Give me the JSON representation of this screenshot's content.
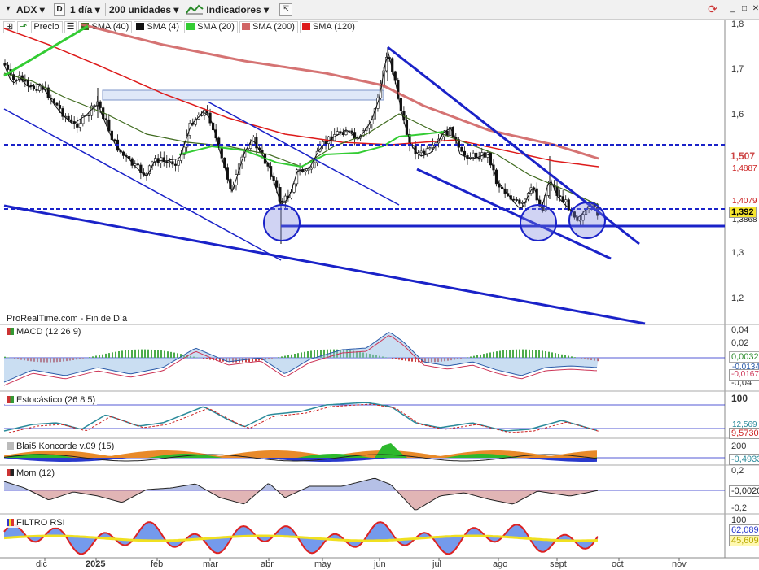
{
  "toolbar": {
    "symbol": "ADX",
    "mode_icon": "D",
    "period": "1 día",
    "units": "200 unidades",
    "indicators": "Indicadores"
  },
  "legend": {
    "precio": "Precio",
    "sma40": "SMA (40)",
    "sma4": "SMA (4)",
    "sma20": "SMA (20)",
    "sma200": "SMA (200)",
    "sma120": "SMA (120)"
  },
  "main": {
    "source_label": "ProRealTime.com - Fin de Día",
    "y_ticks": [
      "1,8",
      "1,7",
      "1,6",
      "1,5",
      "1,4",
      "1,3",
      "1,2"
    ],
    "tags": {
      "sma200": "1,507",
      "sma120": "1,4887",
      "sma40": "1,4079",
      "price": "1,392",
      "sma4": "1,3868"
    }
  },
  "panels": {
    "macd": {
      "label": "MACD (12 26 9)",
      "ticks": [
        "0,04",
        "0,02",
        "0",
        "-0,02",
        "-0,04"
      ],
      "v1": "0,0032",
      "v2": "-0,0134",
      "v3": "-0,0167"
    },
    "stoch": {
      "label": "Estocástico (26 8 5)",
      "ticks": [
        "100"
      ],
      "v1": "12,569",
      "v2": "9,5730"
    },
    "koncorde": {
      "label": "Blai5 Koncorde v.09 (15)",
      "ticks": [
        "200"
      ],
      "v1": "-0,4933"
    },
    "mom": {
      "label": "Mom (12)",
      "ticks": [
        "0,2",
        "-0,2"
      ],
      "v1": "-0,0020"
    },
    "rsi": {
      "label": "FILTRO RSI",
      "ticks": [
        "100"
      ],
      "v1": "62,089",
      "v2": "45,609"
    }
  },
  "x_axis": [
    "dic",
    "2025",
    "feb",
    "mar",
    "abr",
    "may",
    "jun",
    "jul",
    "ago",
    "sept",
    "oct",
    "nov"
  ],
  "colors": {
    "blue_lines": "#1a22c8",
    "sma200": "#d06464",
    "sma120": "#dd1a1a",
    "sma40": "#3f6a1e",
    "sma20": "#33cc33",
    "sma4": "#111111"
  }
}
